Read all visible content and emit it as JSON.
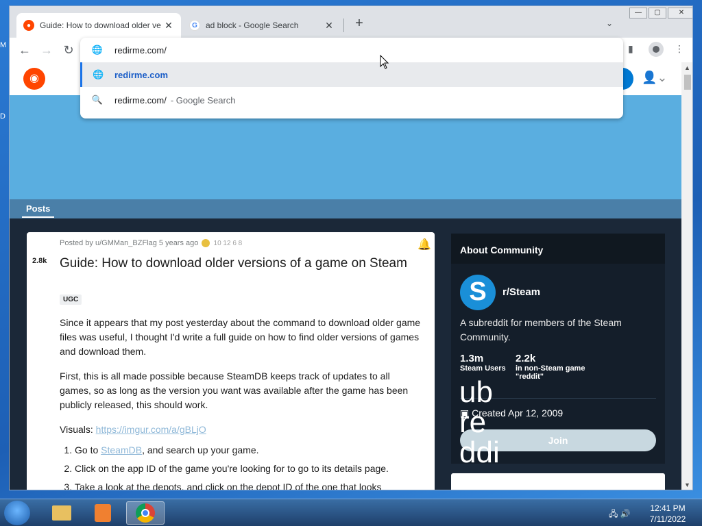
{
  "browser": {
    "tabs": [
      {
        "title": "Guide: How to download older ve",
        "favicon": "reddit-icon",
        "active": true
      },
      {
        "title": "ad block - Google Search",
        "favicon": "google-icon",
        "active": false
      }
    ],
    "new_tab_symbol": "+",
    "address": "redirme.com/",
    "suggestions": [
      {
        "text": "redirme.com",
        "suffix": "",
        "icon": "globe-icon"
      },
      {
        "text": "redirme.com/",
        "suffix": "- Google Search",
        "icon": "search-icon"
      }
    ]
  },
  "desktop": {
    "edge_letters": [
      "M",
      "D"
    ]
  },
  "reddit": {
    "posts_tab": "Posts",
    "post": {
      "votes": "2.8k",
      "meta": "Posted by u/GMMan_BZFlag 5 years ago",
      "award_text": "10   12   6   8",
      "title": "Guide: How to download older versions of a game on Steam",
      "flair": "UGC",
      "paragraph1": "Since it appears that my post yesterday about the command to download older game files was useful, I thought I'd write a full guide on how to find older versions of games and download them.",
      "paragraph2": "First, this is all made possible because SteamDB keeps track of updates to all games, so as long as the version you want was available after the game has been publicly released, this should work.",
      "visuals_label": "Visuals: ",
      "visuals_link": "https://imgur.com/a/gBLjO",
      "step1_pre": "Go to ",
      "step1_link": "SteamDB",
      "step1_post": ", and search up your game.",
      "step2": "Click on the app ID of the game you're looking for to go to its details page.",
      "step3": "Take a look at the depots, and click on the depot ID of the one that looks"
    },
    "sidebar": {
      "header": "About Community",
      "avatar_letter": "S",
      "name": "r/Steam",
      "description": "A subreddit for members of the Steam Community.",
      "stat1_num": "1.3m",
      "stat1_label": "Steam Users",
      "stat2_num": "2.2k",
      "stat2_label": "in non-Steam game \"reddit\"",
      "created": "Created Apr 12, 2009",
      "join": "Join",
      "overflow": "ubreddi"
    }
  },
  "taskbar": {
    "time": "12:41 PM",
    "date": "7/11/2022"
  },
  "colors": {
    "reddit_orange": "#ff4500",
    "banner": "#5aaee0",
    "sidebar_bg": "#141e2a",
    "link": "#8fb8d8"
  }
}
